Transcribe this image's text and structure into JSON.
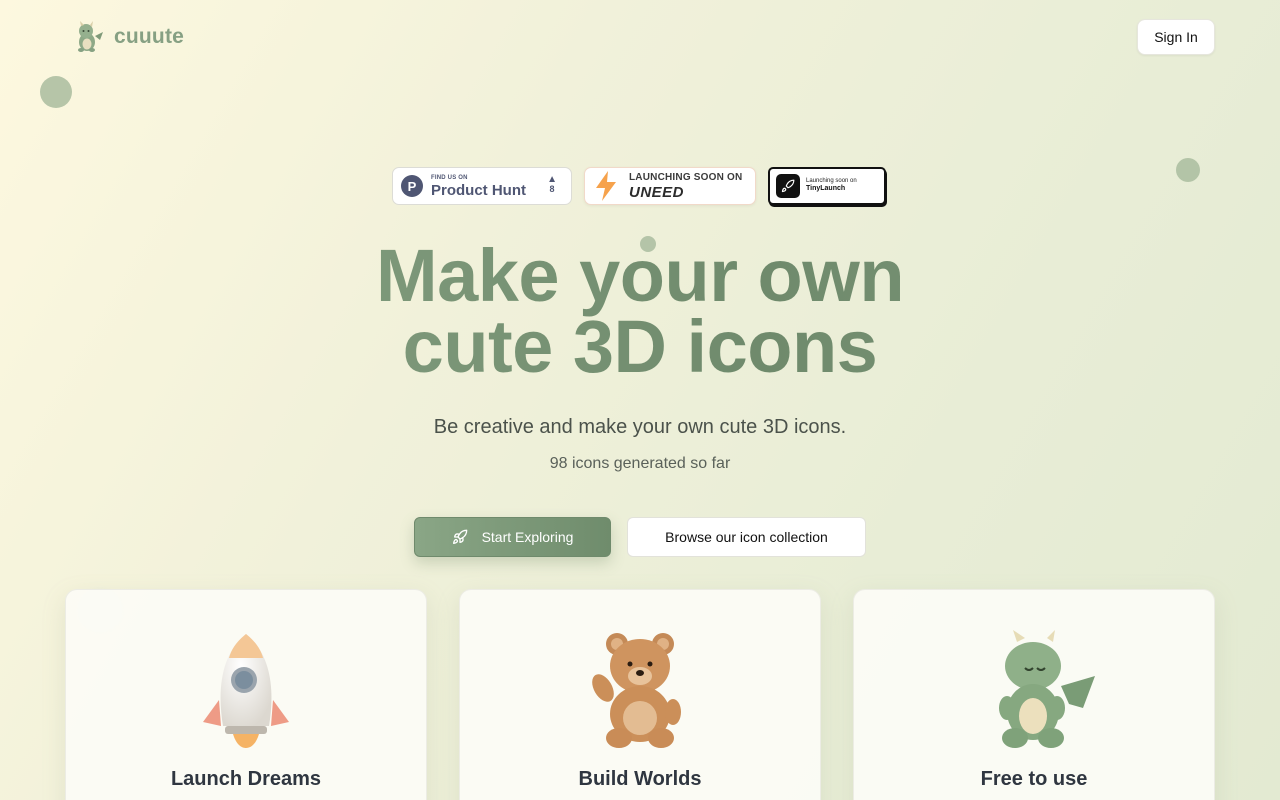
{
  "header": {
    "brand_name": "cuuute",
    "sign_in_label": "Sign In"
  },
  "badges": {
    "product_hunt": {
      "small": "FIND US ON",
      "big": "Product Hunt",
      "votes": "8",
      "letter": "P"
    },
    "uneed": {
      "small": "LAUNCHING SOON ON",
      "big": "UNEED"
    },
    "tinylaunch": {
      "small": "Launching soon on",
      "big": "TinyLaunch"
    }
  },
  "hero": {
    "title_line1": "Make your own",
    "title_line2": "cute 3D icons",
    "subtitle": "Be creative and make your own cute 3D icons.",
    "count_text": "98 icons generated so far"
  },
  "cta": {
    "primary_label": "Start Exploring",
    "secondary_label": "Browse our icon collection"
  },
  "cards": [
    {
      "title": "Launch Dreams",
      "icon": "rocket-icon"
    },
    {
      "title": "Build Worlds",
      "icon": "teddy-bear-icon"
    },
    {
      "title": "Free to use",
      "icon": "dragon-icon"
    }
  ],
  "colors": {
    "accent": "#7d9879",
    "accent_dark": "#6f8c6c",
    "background": "#f1f1da"
  }
}
